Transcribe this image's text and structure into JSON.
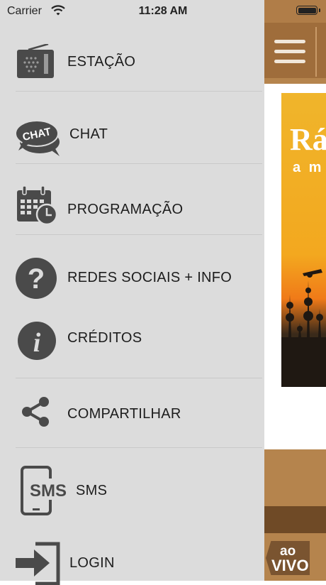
{
  "status_bar": {
    "carrier": "Carrier",
    "time": "11:28 AM"
  },
  "menu": {
    "items": [
      {
        "label": "ESTAÇÃO",
        "icon": "radio-icon"
      },
      {
        "label": "CHAT",
        "icon": "chat-bubble-icon",
        "icon_text": "CHAT"
      },
      {
        "label": "PROGRAMAÇÃO",
        "icon": "calendar-clock-icon"
      },
      {
        "label": "REDES SOCIAIS + INFO",
        "icon": "question-icon"
      },
      {
        "label": "CRÉDITOS",
        "icon": "info-icon"
      },
      {
        "label": "COMPARTILHAR",
        "icon": "share-icon"
      },
      {
        "label": "SMS",
        "icon": "sms-phone-icon",
        "icon_text": "SMS"
      },
      {
        "label": "LOGIN",
        "icon": "login-arrow-icon"
      }
    ]
  },
  "main_view": {
    "banner_title": "Rá",
    "banner_subtitle": "a m",
    "live_badge": {
      "line1": "ao",
      "line2": "VIVO"
    }
  },
  "colors": {
    "menu_bg": "#dcdcdc",
    "icon": "#4a4a4a",
    "brand_brown": "#b5844d",
    "dark_brown": "#6f4a26"
  }
}
